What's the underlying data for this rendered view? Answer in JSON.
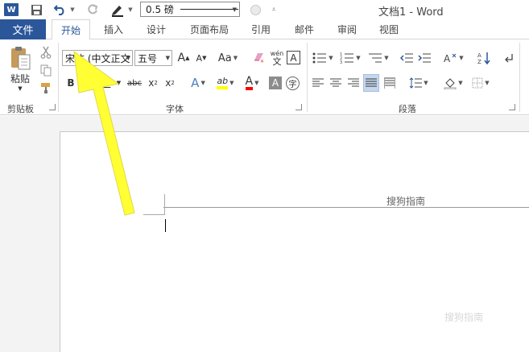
{
  "qat": {
    "word_logo": "W",
    "line_weight": "0.5 磅",
    "window_title": "文档1 - Word"
  },
  "tabs": [
    {
      "label": "文件"
    },
    {
      "label": "开始"
    },
    {
      "label": "插入"
    },
    {
      "label": "设计"
    },
    {
      "label": "页面布局"
    },
    {
      "label": "引用"
    },
    {
      "label": "邮件"
    },
    {
      "label": "审阅"
    },
    {
      "label": "视图"
    }
  ],
  "ribbon": {
    "clipboard": {
      "paste_label": "粘贴",
      "group_label": "剪贴板"
    },
    "font": {
      "font_name": "宋体 (中文正文",
      "font_size": "五号",
      "group_label": "字体",
      "grow": "A",
      "shrink": "A",
      "change_case": "Aa",
      "phonetic_top": "wén",
      "phonetic_bottom": "文",
      "border_char": "A",
      "bold": "B",
      "italic": "I",
      "underline": "U",
      "strike": "abc",
      "subscript": "x",
      "superscript": "x",
      "effects": "A",
      "highlight": "ab",
      "font_color": "A",
      "shading_char": "A",
      "enclose_char": "字",
      "highlight_color": "#ffff00",
      "font_color_value": "#ff0000"
    },
    "paragraph": {
      "group_label": "段落"
    }
  },
  "document": {
    "header_text": "搜狗指南"
  },
  "watermark": "搜狗指南",
  "annotation": {
    "arrow_color": "#ffff33"
  }
}
